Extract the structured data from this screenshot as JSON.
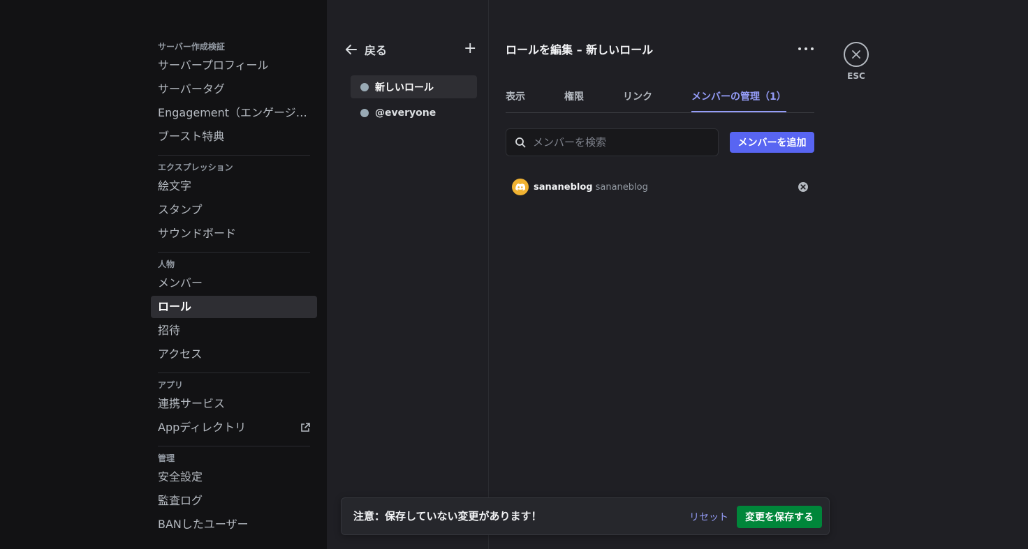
{
  "sidebar": {
    "sections": [
      {
        "header": "サーバー作成検証",
        "items": [
          {
            "label": "サーバープロフィール"
          },
          {
            "label": "サーバータグ"
          },
          {
            "label": "Engagement（エンゲージメント）"
          },
          {
            "label": "ブースト特典"
          }
        ]
      },
      {
        "header": "エクスプレッション",
        "items": [
          {
            "label": "絵文字"
          },
          {
            "label": "スタンプ"
          },
          {
            "label": "サウンドボード"
          }
        ]
      },
      {
        "header": "人物",
        "items": [
          {
            "label": "メンバー"
          },
          {
            "label": "ロール",
            "active": true
          },
          {
            "label": "招待"
          },
          {
            "label": "アクセス"
          }
        ]
      },
      {
        "header": "アプリ",
        "items": [
          {
            "label": "連携サービス"
          },
          {
            "label": "Appディレクトリ",
            "icon": "external-link-icon"
          }
        ]
      },
      {
        "header": "管理",
        "items": [
          {
            "label": "安全設定"
          },
          {
            "label": "監査ログ"
          },
          {
            "label": "BANしたユーザー"
          }
        ]
      }
    ]
  },
  "roles": {
    "back_label": "戻る",
    "add_icon": "plus-icon",
    "items": [
      {
        "label": "新しいロール",
        "color": "#99aab5",
        "active": true
      },
      {
        "label": "@everyone",
        "color": "#99aab5"
      }
    ]
  },
  "main": {
    "title": "ロールを編集 – 新しいロール",
    "more_icon": "more-horizontal-icon",
    "tabs": [
      {
        "label": "表示"
      },
      {
        "label": "権限"
      },
      {
        "label": "リンク"
      },
      {
        "label": "メンバーの管理（1）",
        "active": true
      }
    ],
    "search_placeholder": "メンバーを検索",
    "add_member_label": "メンバーを追加",
    "members": [
      {
        "display_name": "sananeblog",
        "username": "sananeblog",
        "avatar_color": "#f0b232"
      }
    ],
    "close_label": "ESC"
  },
  "notice": {
    "text": "注意：保存していない変更があります！",
    "reset_label": "リセット",
    "save_label": "変更を保存する"
  },
  "colors": {
    "accent": "#5865f2",
    "tab_active": "#949cf7",
    "save": "#00863a"
  }
}
